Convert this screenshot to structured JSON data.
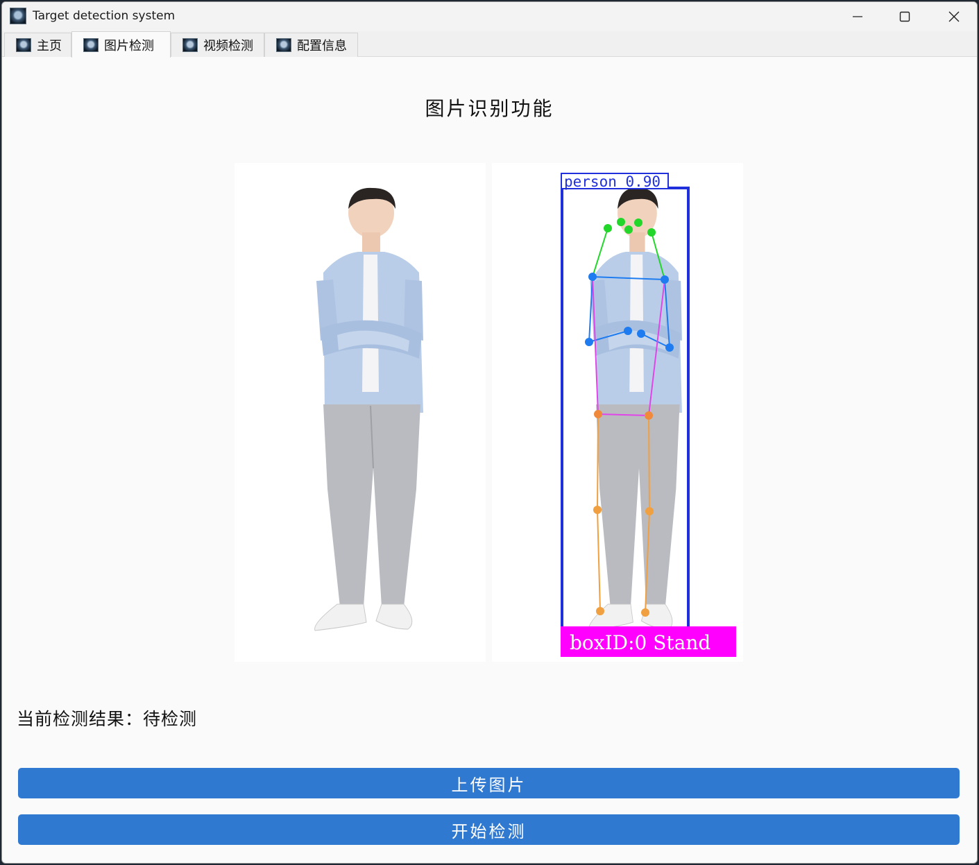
{
  "window": {
    "title": "Target detection system",
    "icon": "app-icon"
  },
  "tabs": [
    {
      "label": "主页",
      "icon": "app-icon",
      "active": false
    },
    {
      "label": "图片检测",
      "icon": "app-icon",
      "active": true
    },
    {
      "label": "视频检测",
      "icon": "app-icon",
      "active": false
    },
    {
      "label": "配置信息",
      "icon": "app-icon",
      "active": false
    }
  ],
  "main": {
    "title": "图片识别功能",
    "detection": {
      "class_label": "person 0.90",
      "id_label": "boxID:0 Stand",
      "box_color": "#1f2fdc",
      "id_label_color": "#ff00ff"
    },
    "result_text": "当前检测结果：待检测",
    "upload_button": "上传图片",
    "detect_button": "开始检测"
  },
  "colors": {
    "accent": "#3079d1",
    "window_bg": "#fafafa",
    "titlebar_bg": "#f3f3f3"
  }
}
